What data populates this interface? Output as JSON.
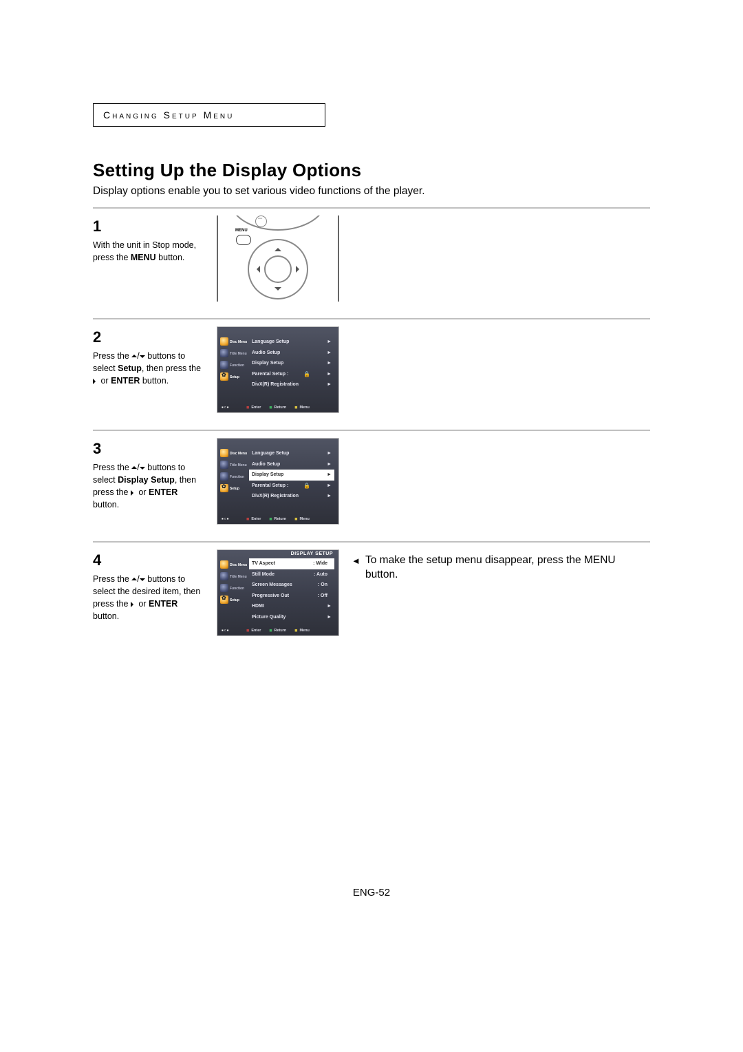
{
  "header": {
    "band": "Changing Setup Menu"
  },
  "title": "Setting Up the Display Options",
  "intro": "Display options enable you to set various video functions of the player.",
  "steps": {
    "s1": {
      "num": "1",
      "pre": "With the unit in Stop mode, press the ",
      "bold": "MENU",
      "post": " button."
    },
    "s2": {
      "num": "2",
      "t1": "Press the ",
      "t2": " buttons to select ",
      "bold": "Setup",
      "t3": ", then press the ",
      "t4": " or ",
      "bold2": "ENTER",
      "t5": " button."
    },
    "s3": {
      "num": "3",
      "t1": "Press the ",
      "t2": " buttons to select ",
      "bold": "Display Setup",
      "t3": ", then press the ",
      "t4": " or ",
      "bold2": "ENTER",
      "t5": " button."
    },
    "s4": {
      "num": "4",
      "t1": "Press the ",
      "t2": " buttons to select the desired item, then press the ",
      "t3": " or ",
      "bold2": "ENTER",
      "t4": " button."
    }
  },
  "remote": {
    "menu_label": "MENU"
  },
  "osd": {
    "tabs": {
      "disc": "Disc Menu",
      "title": "Title Menu",
      "func": "Function",
      "setup": "Setup"
    },
    "setup_items": {
      "lang": "Language Setup",
      "audio": "Audio Setup",
      "display": "Display Setup",
      "parental": "Parental Setup :",
      "divx": "DivX(R) Registration"
    },
    "display_items": {
      "tvaspect": {
        "label": "TV Aspect",
        "value": ": Wide"
      },
      "still": {
        "label": "Still Mode",
        "value": ": Auto"
      },
      "screen": {
        "label": "Screen Messages",
        "value": ": On"
      },
      "prog": {
        "label": "Progressive Out",
        "value": ": Off"
      },
      "hdmi": {
        "label": "HDMI",
        "value": ""
      },
      "pic": {
        "label": "Picture Quality",
        "value": ""
      }
    },
    "display_header": "DISPLAY SETUP",
    "footer": {
      "enter": "Enter",
      "return": "Return",
      "menu": "Menu"
    },
    "corner_hint": "▪▫▪"
  },
  "note": "To make the setup menu disappear, press the MENU button.",
  "page_number": "ENG-52"
}
